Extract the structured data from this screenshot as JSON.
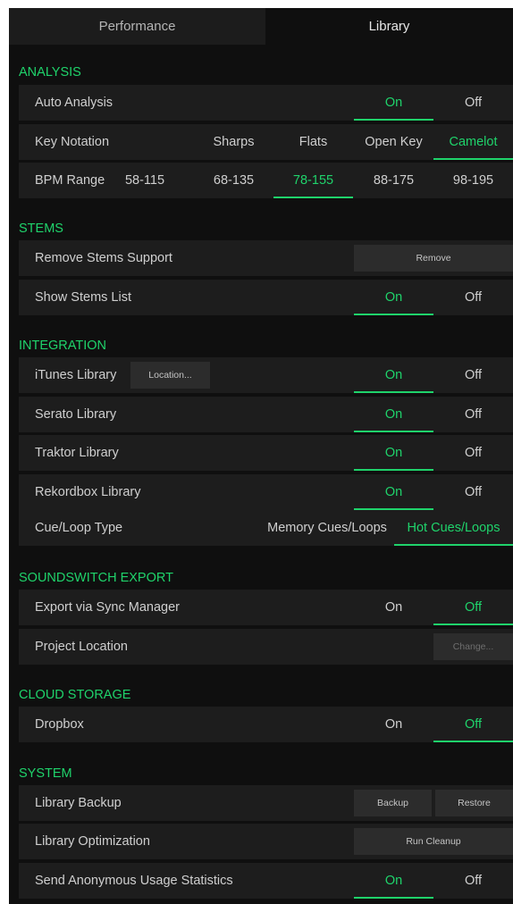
{
  "tabs": {
    "performance": "Performance",
    "library": "Library"
  },
  "colors": {
    "accent": "#1fd36b",
    "panel": "#1d1d1d",
    "background": "#0f0f0f"
  },
  "analysis": {
    "title": "ANALYSIS",
    "auto_analysis": {
      "label": "Auto Analysis",
      "on": "On",
      "off": "Off",
      "selected": "On"
    },
    "key_notation": {
      "label": "Key Notation",
      "options": [
        "Sharps",
        "Flats",
        "Open Key",
        "Camelot"
      ],
      "selected": "Camelot"
    },
    "bpm_range": {
      "label": "BPM Range",
      "options": [
        "58-115",
        "68-135",
        "78-155",
        "88-175",
        "98-195"
      ],
      "selected": "78-155"
    }
  },
  "stems": {
    "title": "STEMS",
    "remove_support": {
      "label": "Remove Stems Support",
      "button": "Remove"
    },
    "show_list": {
      "label": "Show Stems List",
      "on": "On",
      "off": "Off",
      "selected": "On"
    }
  },
  "integration": {
    "title": "INTEGRATION",
    "itunes": {
      "label": "iTunes Library",
      "location_button": "Location...",
      "on": "On",
      "off": "Off",
      "selected": "On"
    },
    "serato": {
      "label": "Serato Library",
      "on": "On",
      "off": "Off",
      "selected": "On"
    },
    "traktor": {
      "label": "Traktor Library",
      "on": "On",
      "off": "Off",
      "selected": "On"
    },
    "rekordbox": {
      "label": "Rekordbox Library",
      "on": "On",
      "off": "Off",
      "selected": "On"
    },
    "cue_loop": {
      "label": "Cue/Loop Type",
      "memory": "Memory Cues/Loops",
      "hot": "Hot Cues/Loops",
      "selected": "Hot Cues/Loops"
    }
  },
  "soundswitch": {
    "title": "SOUNDSWITCH EXPORT",
    "export": {
      "label": "Export via Sync Manager",
      "on": "On",
      "off": "Off",
      "selected": "Off"
    },
    "project_location": {
      "label": "Project Location",
      "button": "Change..."
    }
  },
  "cloud": {
    "title": "CLOUD STORAGE",
    "dropbox": {
      "label": "Dropbox",
      "on": "On",
      "off": "Off",
      "selected": "Off"
    }
  },
  "system": {
    "title": "SYSTEM",
    "backup": {
      "label": "Library Backup",
      "backup_button": "Backup",
      "restore_button": "Restore"
    },
    "optimization": {
      "label": "Library Optimization",
      "button": "Run Cleanup"
    },
    "usage_stats": {
      "label": "Send Anonymous Usage Statistics",
      "on": "On",
      "off": "Off",
      "selected": "On"
    }
  }
}
